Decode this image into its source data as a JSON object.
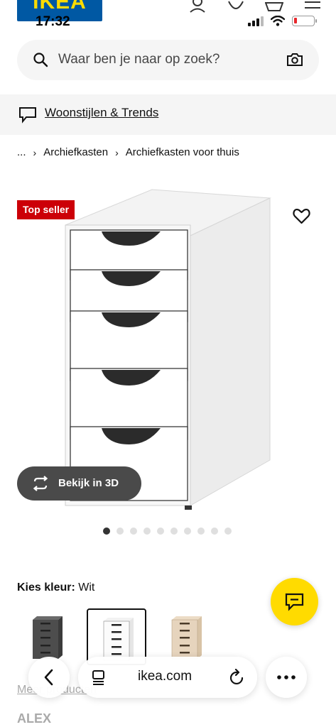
{
  "status_bar": {
    "time": "17:32"
  },
  "header": {
    "logo_text": "IKEA"
  },
  "search": {
    "placeholder": "Waar ben je naar op zoek?"
  },
  "banner": {
    "label": "Woonstijlen & Trends"
  },
  "breadcrumb": {
    "items": [
      "...",
      "Archiefkasten",
      "Archiefkasten voor thuis"
    ]
  },
  "product": {
    "badge": "Top seller",
    "view_3d_label": "Bekijk in 3D",
    "image_count": 10,
    "active_image_index": 0
  },
  "color_picker": {
    "label": "Kies kleur:",
    "selected": "Wit",
    "options": [
      {
        "name": "dark-grey",
        "color": "#4d4d4d"
      },
      {
        "name": "white",
        "color": "#ffffff"
      },
      {
        "name": "oak",
        "color": "#e6d4bd"
      }
    ]
  },
  "below": {
    "link_text": "Meer producten",
    "product_name": "ALEX"
  },
  "browser": {
    "url": "ikea.com"
  },
  "colors": {
    "ikea_blue": "#0058a3",
    "ikea_yellow": "#ffdb00",
    "badge_red": "#cc0008"
  }
}
